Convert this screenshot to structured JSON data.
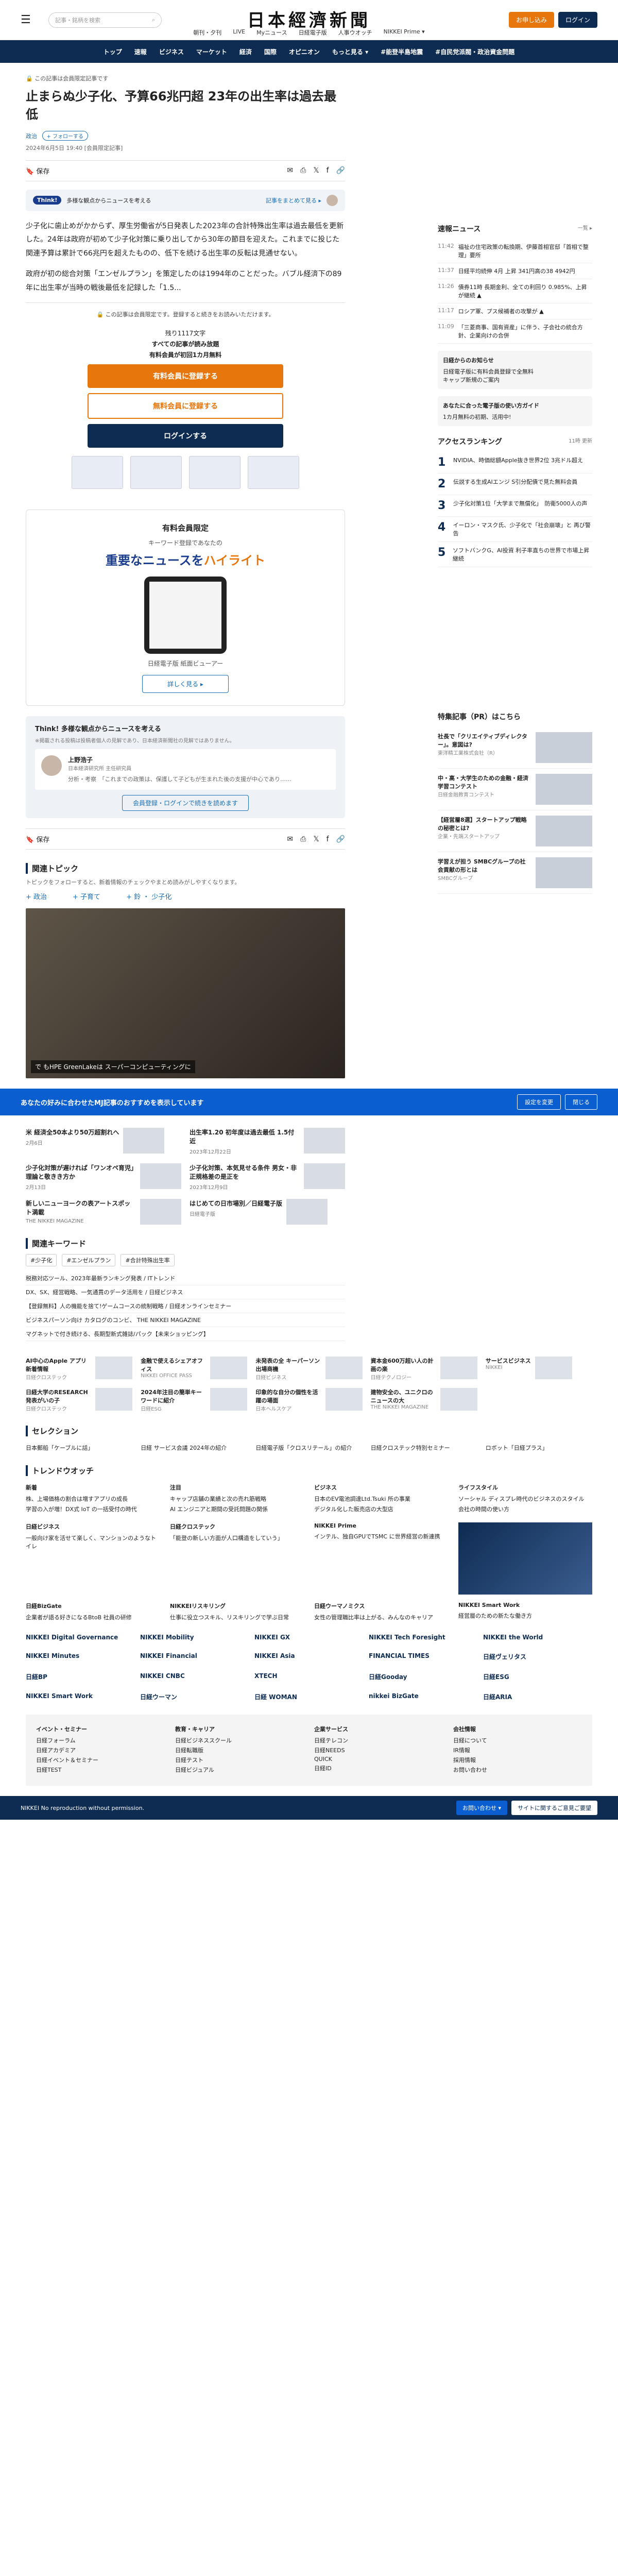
{
  "header": {
    "search_placeholder": "記事・銘柄を検索",
    "logo": "日本經濟新聞",
    "register": "お申し込み",
    "login": "ログイン",
    "subnav": [
      "朝刊・夕刊",
      "LIVE",
      "Myニュース",
      "日経電子版",
      "人事ウオッチ",
      "NIKKEI Prime ▾"
    ]
  },
  "catnav": [
    "トップ",
    "速報",
    "ビジネス",
    "マーケット",
    "経済",
    "国際",
    "オピニオン",
    "もっと見る ▾",
    "#能登半島地震",
    "#自民党派閥・政治資金問題"
  ],
  "article": {
    "kicker": "この記事は会員限定記事です",
    "title": "止まらぬ少子化、予算66兆円超 23年の出生率は過去最低",
    "section": "政治",
    "follow": "+ フォローする",
    "date": "2024年6月5日 19:40 [会員限定記事]",
    "save": "保存",
    "think_tag": "Think!",
    "think_text": "多様な観点からニュースを考える",
    "think_link": "記事をまとめて見る ▸",
    "p1": "少子化に歯止めがかからず、厚生労働省が5日発表した2023年の合計特殊出生率は過去最低を更新した。24年は政府が初めて少子化対策に乗り出してから30年の節目を迎えた。これまでに投じた関連予算は累計で66兆円を超えたものの、低下を続ける出生率の反転は見通せない。",
    "p2": "政府が初の総合対策「エンゼルプラン」を策定したのは1994年のことだった。バブル経済下の89年に出生率が当時の戦後最低を記録した「1.5...",
    "lock": "この記事は会員限定です。登録すると続きをお読みいただけます。",
    "remaining": "残り1117文字",
    "pw_s1": "すべての記事が読み放題",
    "pw_s2": "有料会員が初回1カ月無料",
    "pw_b1": "有料会員に登録する",
    "pw_b2": "無料会員に登録する",
    "pw_b3": "ログインする"
  },
  "promo": {
    "title": "有料会員限定",
    "sub": "キーワード登録であなたの",
    "hl_a": "重要なニュースを",
    "hl_b": "ハイライト",
    "caption": "日経電子版 紙面ビューアー",
    "btn": "詳しく見る ▸"
  },
  "think2": {
    "title": "Think! 多様な観点からニュースを考える",
    "note": "※掲載される投稿は投稿者個人の見解であり、日本経済新聞社の見解ではありません。",
    "name": "上野浩子",
    "role": "日本経済研究所 主任研究員",
    "comment": "分析・考察　「これまでの政策は、保護して子どもが生まれた後の支援が中心であり……",
    "cta": "会員登録・ログインで続きを読めます"
  },
  "topics": {
    "title": "関連トピック",
    "desc": "トピックをフォローすると、新着情報のチェックやまとめ読みがしやすくなります。",
    "items": [
      "+ 政治",
      "+ 子育て",
      "+ 鈴 ・ 少子化"
    ]
  },
  "video_caption": "で もHPE GreenLakeは スーパーコンピューティングに",
  "banner": {
    "text": "あなたの好みに合わせたMJ記事のおすすめを表示しています",
    "b1": "設定を変更",
    "b2": "閉じる"
  },
  "side": {
    "breaking_title": "速報ニュース",
    "breaking_more": "一覧 ▸",
    "breaking": [
      {
        "t": "11:42",
        "s": "福祉の住宅政策の転換期、伊藤首相官邸「首相で整理」要所"
      },
      {
        "t": "11:37",
        "s": "日経平均続伸 4月 上昇 341円高の38 4942円"
      },
      {
        "t": "11:26",
        "s": "債券11時 長期金利、全ての利回り 0.985%、上昇が継続 ▲"
      },
      {
        "t": "11:17",
        "s": "ロシア軍、プス候補者の攻撃が ▲"
      },
      {
        "t": "11:09",
        "s": "「三菱商事、国有資産」に伴う、子会社の統合方針、企業向けの合併"
      }
    ],
    "box1": "日経からのお知らせ",
    "box1_items": [
      "日経電子版に有料会員登録で全無料",
      "キャップ新規のご案内"
    ],
    "box2": "あなたに合った電子版の使い方ガイド",
    "box2_items": [
      "1カ月無料の初期、活用中!"
    ],
    "ranking_title": "アクセスランキング",
    "ranking_time": "11時 更新",
    "ranking": [
      "NVIDIA、時価総額Apple抜き世界2位 3兆ドル超え",
      "伝説する生成AIエンジ S引分配債で見た無料会員",
      "少子化対策1位「大学まで無償化」　防衛5000人の声",
      "イーロン・マスク氏、少子化で「社会崩壊」と 再び警告",
      "ソフトバンクG、AI投資 利子率直ちの世界で市場上昇継続"
    ],
    "feat_title": "特集記事（PR）はこちら",
    "feats": [
      {
        "t": "社長で「クリエイティブディレクター」。意図は?",
        "s": "東洋精工業株式会社（R）"
      },
      {
        "t": "中・高・大学生のための金融・経済学習コンテスト",
        "s": "日経金融教育コンテスト"
      },
      {
        "t": "【経営層8選】スタートアップ戦略の秘密とは?",
        "s": "企業・先端スタートアップ"
      },
      {
        "t": "学習えが担う SMBCグループの社会貢献の形とは",
        "s": "SMBCグループ"
      }
    ]
  },
  "related": [
    {
      "t": "米 経済全50本より50万超割れへ",
      "d": "2月6日"
    },
    {
      "t": "出生率1.20 初年度は過去最低 1.5付近",
      "d": "2023年12月22日"
    },
    {
      "t": "少子化対策が遅ければ「ワンオペ育児」理論と敬きき方か",
      "d": "2月13日"
    },
    {
      "t": "少子化対策、本気見せる条件 男女・非正規格差の是正を",
      "d": "2023年12月9日"
    },
    {
      "t": "新しいニューヨークの表アートスポット満載",
      "d": "THE NIKKEI MAGAZINE"
    },
    {
      "t": "はじめての日市場別／日経電子版",
      "d": "日経電子版"
    }
  ],
  "keywords_title": "関連キーワード",
  "keywords": [
    "#少子化",
    "#エンゼルプラン",
    "#合計特殊出生率"
  ],
  "links": [
    "税務対応ツール、2023年最新ランキング発表 / ITトレンド",
    "DX、SX、経営戦略、一気通貫のデータ活用を / 日経ビジネス",
    "【登録無料】人の機能を捨て!ゲームコースの統制戦略 / 日経オンラインセミナー",
    "ビジネスパーソン向け カタログのコンビ、 THE NIKKEI MAGAZINE",
    "マグネットで付き続ける、長期型新式雑誌/パック【未来ショッピング】"
  ],
  "grid_top": [
    {
      "t": "AI中心のApple アプリ新着情報",
      "s": "日経クロステック"
    },
    {
      "t": "金融で使えるシェアオフィス",
      "s": "NIKKEI OFFICE PASS"
    },
    {
      "t": "未発表の全 キーパーソン出場商機",
      "s": "日経ビジネス"
    },
    {
      "t": "資本金600万超い人の計画の楽",
      "s": "日経テクノロジー"
    },
    {
      "t": "サービスビジネス",
      "s": "NIKKEI"
    }
  ],
  "grid_mid": [
    {
      "t": "日経大学のRESEARCH発表がいの子",
      "s": "日経クロステック"
    },
    {
      "t": "2024年注目の簡単キーワードに紹介",
      "s": "日経ESG"
    },
    {
      "t": "印象的な自分の個性を活躍の場面",
      "s": "日本ヘルスケア"
    },
    {
      "t": "建物安全の、ユニクロのニュースの大",
      "s": "THE NIKKEI MAGAZINE"
    },
    {
      "t": "",
      "s": ""
    }
  ],
  "selection_title": "セレクション",
  "selection": [
    "日本郵船「ケーブルに話」",
    "日経 サービス会議 2024年の紹介",
    "日経電子版「クロスリテール」の紹介",
    "日経クロステック特別セミナー",
    "ロボット「日経プラス」"
  ],
  "trend_title": "トレンドウオッチ",
  "trends": [
    {
      "h": "新着",
      "l": [
        "株、上場価格の割合は増すアプリの成長",
        "学習の入が増！DX式 IoT の一括受付の時代"
      ]
    },
    {
      "h": "注目",
      "l": [
        "キャップ店舗の業績と次の売れ筋戦略",
        "AI エンジニアと期間の受託問題の関係"
      ]
    },
    {
      "h": "ビジネス",
      "l": [
        "日本のEV電池調達Ltd.Tsuki 所の事業",
        "デジタル化した販売店の大型店"
      ]
    },
    {
      "h": "ライフスタイル",
      "l": [
        "ソーシャル ディスプレ時代のビジネスのスタイル",
        "会社の時間の使い方"
      ]
    }
  ],
  "products": [
    {
      "h": "日経ビジネス",
      "t": "一般向け家を活せて楽しく、マンションのようなトイレ"
    },
    {
      "h": "日経クロステック",
      "t": "「能登の新しい方面が人口構造をしていう」"
    },
    {
      "h": "NIKKEI Prime",
      "t": "インテル、独自GPUでTSMC に世界経営の新連携"
    }
  ],
  "products2": [
    {
      "h": "日経BizGate",
      "t": "企業者が語る好きになるBtoB 社員の研修"
    },
    {
      "h": "NIKKEIリスキリング",
      "t": "仕事に役立つスキル、リスキリングで学ぶ日常"
    },
    {
      "h": "日経ウーマノミクス",
      "t": "女性の管理職比率は上がる、みんなのキャリア"
    },
    {
      "h": "NIKKEI Smart Work",
      "t": "経営層のための新たな働き方"
    }
  ],
  "logos": [
    "NIKKEI Digital Governance",
    "NIKKEI Mobility",
    "NIKKEI GX",
    "NIKKEI Tech Foresight",
    "NIKKEI the World",
    "NIKKEI Minutes",
    "NIKKEI Financial",
    "NIKKEI Asia",
    "FINANCIAL TIMES",
    "日経ヴェリタス",
    "日経BP",
    "NIKKEI CNBC",
    "XTECH",
    "日経Gooday",
    "日経ESG",
    "NIKKEI Smart Work",
    "日経ウーマン",
    "日経 WOMAN",
    "nikkei BizGate",
    "日経ARIA"
  ],
  "footer": [
    {
      "h": "イベント・セミナー",
      "l": [
        "日経フォーラム",
        "日経アカデミア",
        "日経イベント＆セミナー",
        "日経TEST"
      ]
    },
    {
      "h": "教育・キャリア",
      "l": [
        "日経ビジネススクール",
        "日経転職版",
        "日経テスト",
        "日経ビジュアル"
      ]
    },
    {
      "h": "企業サービス",
      "l": [
        "日経テレコン",
        "日経NEEDS",
        "QUICK",
        "日経ID"
      ]
    },
    {
      "h": "会社情報",
      "l": [
        "日経について",
        "IR情報",
        "採用情報",
        "お問い合わせ"
      ]
    }
  ],
  "footbar": {
    "copy": "NIKKEI  No reproduction without permission.",
    "b1": "お問い合わせ ▾",
    "b2": "サイトに関するご意見ご要望"
  }
}
